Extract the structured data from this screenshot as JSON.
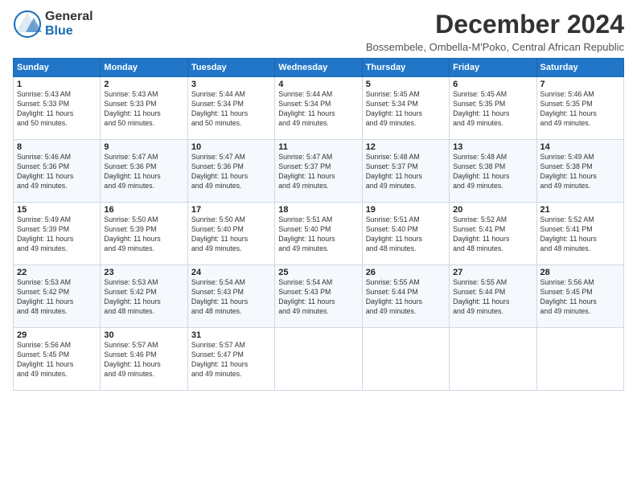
{
  "logo": {
    "general": "General",
    "blue": "Blue"
  },
  "title": "December 2024",
  "subtitle": "Bossembele, Ombella-M'Poko, Central African Republic",
  "headers": [
    "Sunday",
    "Monday",
    "Tuesday",
    "Wednesday",
    "Thursday",
    "Friday",
    "Saturday"
  ],
  "weeks": [
    [
      {
        "day": "1",
        "info": "Sunrise: 5:43 AM\nSunset: 5:33 PM\nDaylight: 11 hours\nand 50 minutes."
      },
      {
        "day": "2",
        "info": "Sunrise: 5:43 AM\nSunset: 5:33 PM\nDaylight: 11 hours\nand 50 minutes."
      },
      {
        "day": "3",
        "info": "Sunrise: 5:44 AM\nSunset: 5:34 PM\nDaylight: 11 hours\nand 50 minutes."
      },
      {
        "day": "4",
        "info": "Sunrise: 5:44 AM\nSunset: 5:34 PM\nDaylight: 11 hours\nand 49 minutes."
      },
      {
        "day": "5",
        "info": "Sunrise: 5:45 AM\nSunset: 5:34 PM\nDaylight: 11 hours\nand 49 minutes."
      },
      {
        "day": "6",
        "info": "Sunrise: 5:45 AM\nSunset: 5:35 PM\nDaylight: 11 hours\nand 49 minutes."
      },
      {
        "day": "7",
        "info": "Sunrise: 5:46 AM\nSunset: 5:35 PM\nDaylight: 11 hours\nand 49 minutes."
      }
    ],
    [
      {
        "day": "8",
        "info": "Sunrise: 5:46 AM\nSunset: 5:36 PM\nDaylight: 11 hours\nand 49 minutes."
      },
      {
        "day": "9",
        "info": "Sunrise: 5:47 AM\nSunset: 5:36 PM\nDaylight: 11 hours\nand 49 minutes."
      },
      {
        "day": "10",
        "info": "Sunrise: 5:47 AM\nSunset: 5:36 PM\nDaylight: 11 hours\nand 49 minutes."
      },
      {
        "day": "11",
        "info": "Sunrise: 5:47 AM\nSunset: 5:37 PM\nDaylight: 11 hours\nand 49 minutes."
      },
      {
        "day": "12",
        "info": "Sunrise: 5:48 AM\nSunset: 5:37 PM\nDaylight: 11 hours\nand 49 minutes."
      },
      {
        "day": "13",
        "info": "Sunrise: 5:48 AM\nSunset: 5:38 PM\nDaylight: 11 hours\nand 49 minutes."
      },
      {
        "day": "14",
        "info": "Sunrise: 5:49 AM\nSunset: 5:38 PM\nDaylight: 11 hours\nand 49 minutes."
      }
    ],
    [
      {
        "day": "15",
        "info": "Sunrise: 5:49 AM\nSunset: 5:39 PM\nDaylight: 11 hours\nand 49 minutes."
      },
      {
        "day": "16",
        "info": "Sunrise: 5:50 AM\nSunset: 5:39 PM\nDaylight: 11 hours\nand 49 minutes."
      },
      {
        "day": "17",
        "info": "Sunrise: 5:50 AM\nSunset: 5:40 PM\nDaylight: 11 hours\nand 49 minutes."
      },
      {
        "day": "18",
        "info": "Sunrise: 5:51 AM\nSunset: 5:40 PM\nDaylight: 11 hours\nand 49 minutes."
      },
      {
        "day": "19",
        "info": "Sunrise: 5:51 AM\nSunset: 5:40 PM\nDaylight: 11 hours\nand 48 minutes."
      },
      {
        "day": "20",
        "info": "Sunrise: 5:52 AM\nSunset: 5:41 PM\nDaylight: 11 hours\nand 48 minutes."
      },
      {
        "day": "21",
        "info": "Sunrise: 5:52 AM\nSunset: 5:41 PM\nDaylight: 11 hours\nand 48 minutes."
      }
    ],
    [
      {
        "day": "22",
        "info": "Sunrise: 5:53 AM\nSunset: 5:42 PM\nDaylight: 11 hours\nand 48 minutes."
      },
      {
        "day": "23",
        "info": "Sunrise: 5:53 AM\nSunset: 5:42 PM\nDaylight: 11 hours\nand 48 minutes."
      },
      {
        "day": "24",
        "info": "Sunrise: 5:54 AM\nSunset: 5:43 PM\nDaylight: 11 hours\nand 48 minutes."
      },
      {
        "day": "25",
        "info": "Sunrise: 5:54 AM\nSunset: 5:43 PM\nDaylight: 11 hours\nand 49 minutes."
      },
      {
        "day": "26",
        "info": "Sunrise: 5:55 AM\nSunset: 5:44 PM\nDaylight: 11 hours\nand 49 minutes."
      },
      {
        "day": "27",
        "info": "Sunrise: 5:55 AM\nSunset: 5:44 PM\nDaylight: 11 hours\nand 49 minutes."
      },
      {
        "day": "28",
        "info": "Sunrise: 5:56 AM\nSunset: 5:45 PM\nDaylight: 11 hours\nand 49 minutes."
      }
    ],
    [
      {
        "day": "29",
        "info": "Sunrise: 5:56 AM\nSunset: 5:45 PM\nDaylight: 11 hours\nand 49 minutes."
      },
      {
        "day": "30",
        "info": "Sunrise: 5:57 AM\nSunset: 5:46 PM\nDaylight: 11 hours\nand 49 minutes."
      },
      {
        "day": "31",
        "info": "Sunrise: 5:57 AM\nSunset: 5:47 PM\nDaylight: 11 hours\nand 49 minutes."
      },
      {
        "day": "",
        "info": ""
      },
      {
        "day": "",
        "info": ""
      },
      {
        "day": "",
        "info": ""
      },
      {
        "day": "",
        "info": ""
      }
    ]
  ]
}
